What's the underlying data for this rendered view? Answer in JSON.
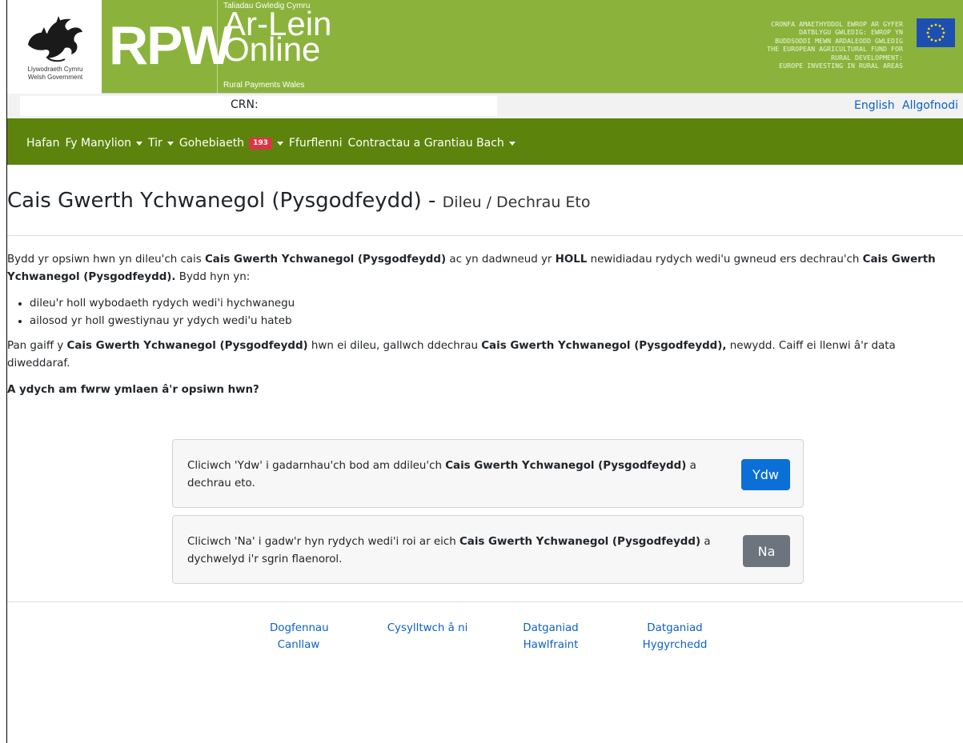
{
  "banner": {
    "gov_name_cy": "Llywodraeth Cymru",
    "gov_name_en": "Welsh Government",
    "rpw_logo": "RPW",
    "tagline_small": "Taliadau Gwledig Cymru",
    "tagline_cy": "Ar-Lein",
    "tagline_en": "Online",
    "tagline_foot": "Rural Payments Wales",
    "eu_text_cy_1": "CRONFA AMAETHYDDOL EWROP AR GYFER",
    "eu_text_cy_2": "DATBLYGU GWLEDIG: EWROP YN",
    "eu_text_cy_3": "BUDDSODDI MEWN ARDALEODD GWLEDIG",
    "eu_text_en_1": "THE EUROPEAN AGRICULTURAL FUND FOR",
    "eu_text_en_2": "RURAL DEVELOPMENT:",
    "eu_text_en_3": "EUROPE INVESTING IN RURAL AREAS",
    "brand_color": "#8bb33c"
  },
  "crn_label": "CRN:",
  "top_links": {
    "english": "English",
    "logout": "Allgofnodi"
  },
  "nav": {
    "home": "Hafan",
    "my_details": "Fy Manylion",
    "land": "Tir",
    "correspondence": "Gohebiaeth",
    "correspondence_badge": "193",
    "forms": "Ffurflenni",
    "contracts": "Contractau a Grantiau Bach",
    "bg_color": "#5c840c"
  },
  "heading": {
    "title": "Cais Gwerth Ychwanegol (Pysgodfeydd) - ",
    "subtitle": "Dileu / Dechrau Eto"
  },
  "body": {
    "p1_a": "Bydd yr opsiwn hwn yn dileu'ch cais ",
    "p1_b": "Cais Gwerth Ychwanegol (Pysgodfeydd)",
    "p1_c": " ac yn dadwneud yr ",
    "p1_d": "HOLL",
    "p1_e": " newidiadau rydych wedi'u gwneud ers dechrau'ch ",
    "p1_f": "Cais Gwerth Ychwanegol (Pysgodfeydd).",
    "p1_g": " Bydd hyn yn:",
    "bullet_1": "dileu'r holl wybodaeth rydych wedi'i hychwanegu",
    "bullet_2": "ailosod yr holl gwestiynau yr ydych wedi'u hateb",
    "p2_a": "Pan gaiff y ",
    "p2_b": "Cais Gwerth Ychwanegol (Pysgodfeydd)",
    "p2_c": " hwn ei dileu, gallwch ddechrau ",
    "p2_d": "Cais Gwerth Ychwanegol (Pysgodfeydd),",
    "p2_e": " newydd. Caiff ei llenwi â'r data diweddaraf.",
    "question": "A ydych am fwrw ymlaen â'r opsiwn hwn?"
  },
  "card_yes": {
    "text_a": "Cliciwch 'Ydw' i gadarnhau'ch bod am ddileu'ch ",
    "text_b": "Cais Gwerth Ychwanegol (Pysgodfeydd)",
    "text_c": " a dechrau eto.",
    "button": "Ydw"
  },
  "card_no": {
    "text_a": "Cliciwch 'Na' i gadw'r hyn rydych wedi'i roi ar eich ",
    "text_b": "Cais Gwerth Ychwanegol (Pysgodfeydd)",
    "text_c": " a dychwelyd i'r sgrin flaenorol.",
    "button": "Na"
  },
  "footer": {
    "docs_1": "Dogfennau",
    "docs_2": "Canllaw",
    "contact": "Cysylltwch â ni",
    "copyright_1": "Datganiad",
    "copyright_2": "Hawlfraint",
    "accessibility_1": "Datganiad",
    "accessibility_2": "Hygyrchedd"
  }
}
